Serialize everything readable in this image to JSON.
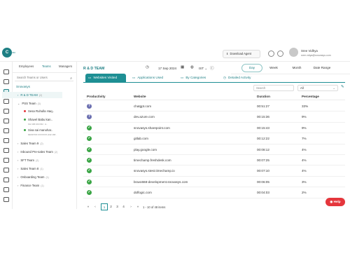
{
  "header": {
    "logo_text": "C",
    "logo_sub": "360",
    "download_label": "Download Agent",
    "user_name": "Sree Vidhya",
    "user_email": "sree.vidya@snovasys.com"
  },
  "rail_icons": [
    "globe-icon",
    "clock-icon",
    "dashboard-icon",
    "list-icon",
    "monitor-icon",
    "timer-icon",
    "tracker-icon",
    "person-icon",
    "calendar-icon",
    "briefcase-icon",
    "people-icon",
    "document-icon",
    "settings-icon",
    "sitemap-icon"
  ],
  "panel": {
    "tabs": [
      "Employees",
      "Teams",
      "Managers"
    ],
    "search_placeholder": "Search Teams or Users",
    "org_name": "Snovasys",
    "tree": [
      {
        "label": "R & D TEAM",
        "count": "(2)",
        "active": true
      },
      {
        "label": "PSS Team",
        "count": "(3)"
      },
      {
        "label": "Sales Team 9",
        "count": "(2)"
      },
      {
        "label": "Inbound Pre-sales Team",
        "count": "(2)"
      },
      {
        "label": "SFT Team",
        "count": "(2)"
      },
      {
        "label": "Sales Team 8",
        "count": "(1)"
      },
      {
        "label": "Onboarding Team",
        "count": "(1)"
      },
      {
        "label": "Finance Team",
        "count": "(1)"
      }
    ],
    "members": [
      {
        "name": "Sesa Ruhulla Haq..",
        "sub": "",
        "status_color": "#e5363c"
      },
      {
        "name": "Shavel Babu kan..",
        "sub": "192.168.100.6/32 · H..",
        "status_color": "#3aa545"
      },
      {
        "name": "Siva sai manohar..",
        "sub": "DESKTOP-XXXXXXX (192.168..",
        "status_color": "#3aa545"
      }
    ]
  },
  "main": {
    "title": "R & D TEAM",
    "date": "17 Sep 2024",
    "timezone": "IST",
    "ranges": [
      "Day",
      "Week",
      "Month",
      "Date Range"
    ],
    "active_range": "Day",
    "view_tabs": [
      {
        "label": "Websites Visited",
        "icon": "▭"
      },
      {
        "label": "Applications Used",
        "icon": "▭"
      },
      {
        "label": "By Categories",
        "icon": "▭"
      },
      {
        "label": "Detailed Activity",
        "icon": "◷"
      }
    ],
    "table_search_placeholder": "Search",
    "filter_value": "All",
    "columns": [
      "Productivity",
      "Website",
      "Duration",
      "Percentage"
    ],
    "rows": [
      {
        "productivity": "neutral",
        "website": "chatgpt.com",
        "duration": "00:51:27",
        "percentage": "33%"
      },
      {
        "productivity": "neutral",
        "website": "dev.azure.com",
        "duration": "00:15:36",
        "percentage": "9%"
      },
      {
        "productivity": "productive",
        "website": "snovasys.sharepoint.com",
        "duration": "00:15:43",
        "percentage": "9%"
      },
      {
        "productivity": "productive",
        "website": "gitlab.com",
        "duration": "00:12:22",
        "percentage": "7%"
      },
      {
        "productivity": "productive",
        "website": "play.google.com",
        "duration": "00:08:12",
        "percentage": "4%"
      },
      {
        "productivity": "productive",
        "website": "timechamp.freshdesk.com",
        "duration": "00:07:25",
        "percentage": "4%"
      },
      {
        "productivity": "productive",
        "website": "snovasys.stest.timechamp.io",
        "duration": "00:07:10",
        "percentage": "4%"
      },
      {
        "productivity": "productive",
        "website": "bravo668-development.snovasys.com",
        "duration": "00:06:05",
        "percentage": "3%"
      },
      {
        "productivity": "productive",
        "website": "doflogic.com",
        "duration": "00:04:03",
        "percentage": "2%"
      }
    ],
    "pagination": {
      "pages": [
        "1",
        "2",
        "3",
        "4"
      ],
      "active_page": "1",
      "info": "1 - 10 of 48 items"
    }
  },
  "help_label": "Help",
  "colors": {
    "accent": "#1e8f94",
    "neutral": "#6b6fb0",
    "productive": "#3aa545",
    "help": "#e5363c"
  }
}
